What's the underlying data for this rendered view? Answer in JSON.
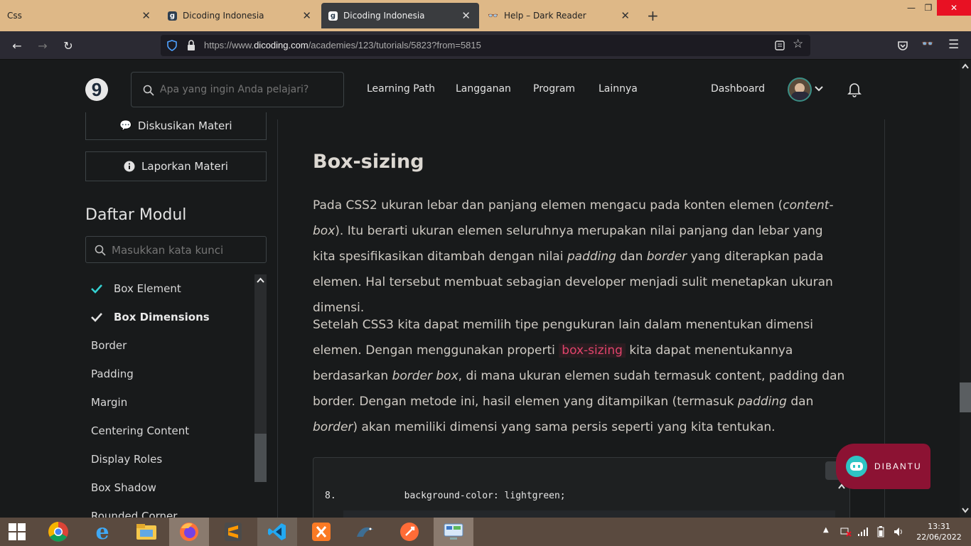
{
  "browser": {
    "tabs": [
      {
        "title": "Css"
      },
      {
        "title": "Dicoding Indonesia"
      },
      {
        "title": "Dicoding Indonesia"
      },
      {
        "title": "Help – Dark Reader"
      }
    ],
    "url_prefix": "https://www.",
    "url_domain": "dicoding.com",
    "url_path": "/academies/123/tutorials/5823?from=5815"
  },
  "site": {
    "logo": "9",
    "search_placeholder": "Apa yang ingin Anda pelajari?",
    "menu": [
      "Learning Path",
      "Langganan",
      "Program",
      "Lainnya"
    ],
    "dashboard": "Dashboard"
  },
  "sidebar": {
    "discuss_label": "Diskusikan Materi",
    "report_label": "Laporkan Materi",
    "module_title": "Daftar Modul",
    "module_search_placeholder": "Masukkan kata kunci",
    "items": [
      {
        "label": "Box Element",
        "done": true,
        "bold": false
      },
      {
        "label": "Box Dimensions",
        "done": true,
        "bold": true
      },
      {
        "label": "Border",
        "done": false
      },
      {
        "label": "Padding",
        "done": false
      },
      {
        "label": "Margin",
        "done": false
      },
      {
        "label": "Centering Content",
        "done": false
      },
      {
        "label": "Display Roles",
        "done": false
      },
      {
        "label": "Box Shadow",
        "done": false
      },
      {
        "label": "Rounded Corner",
        "done": false
      }
    ]
  },
  "article": {
    "heading": "Box-sizing",
    "p1": {
      "a": "Pada CSS2 ukuran lebar dan panjang elemen mengacu pada konten elemen (",
      "b": "content-box",
      "c": "). Itu berarti ukuran elemen seluruhnya merupakan nilai panjang dan lebar yang kita spesifikasikan ditambah dengan nilai ",
      "d": "padding",
      "e": " dan ",
      "f": "border",
      "g": " yang diterapkan pada elemen. Hal tersebut membuat sebagian developer menjadi sulit menetapkan ukuran dimensi."
    },
    "p2": {
      "a": "Setelah CSS3 kita dapat memilih tipe pengukuran lain dalam menentukan dimensi elemen. Dengan menggunakan properti ",
      "code": "box-sizing",
      "b": " kita dapat menentukannya berdasarkan ",
      "c": "border box",
      "d": ", di mana ukuran elemen sudah termasuk content, padding dan border. Dengan metode ini, hasil elemen yang ditampilkan (termasuk ",
      "e": "padding",
      "f": " dan ",
      "g": "border",
      "h": ") akan memiliki dimensi yang sama persis seperti yang kita tentukan."
    },
    "code": {
      "line_number": "8.",
      "line_text": "background-color: lightgreen;"
    }
  },
  "chat_widget": {
    "label": "DIBANTU"
  },
  "taskbar": {
    "time": "13:31",
    "date": "22/06/2022"
  }
}
